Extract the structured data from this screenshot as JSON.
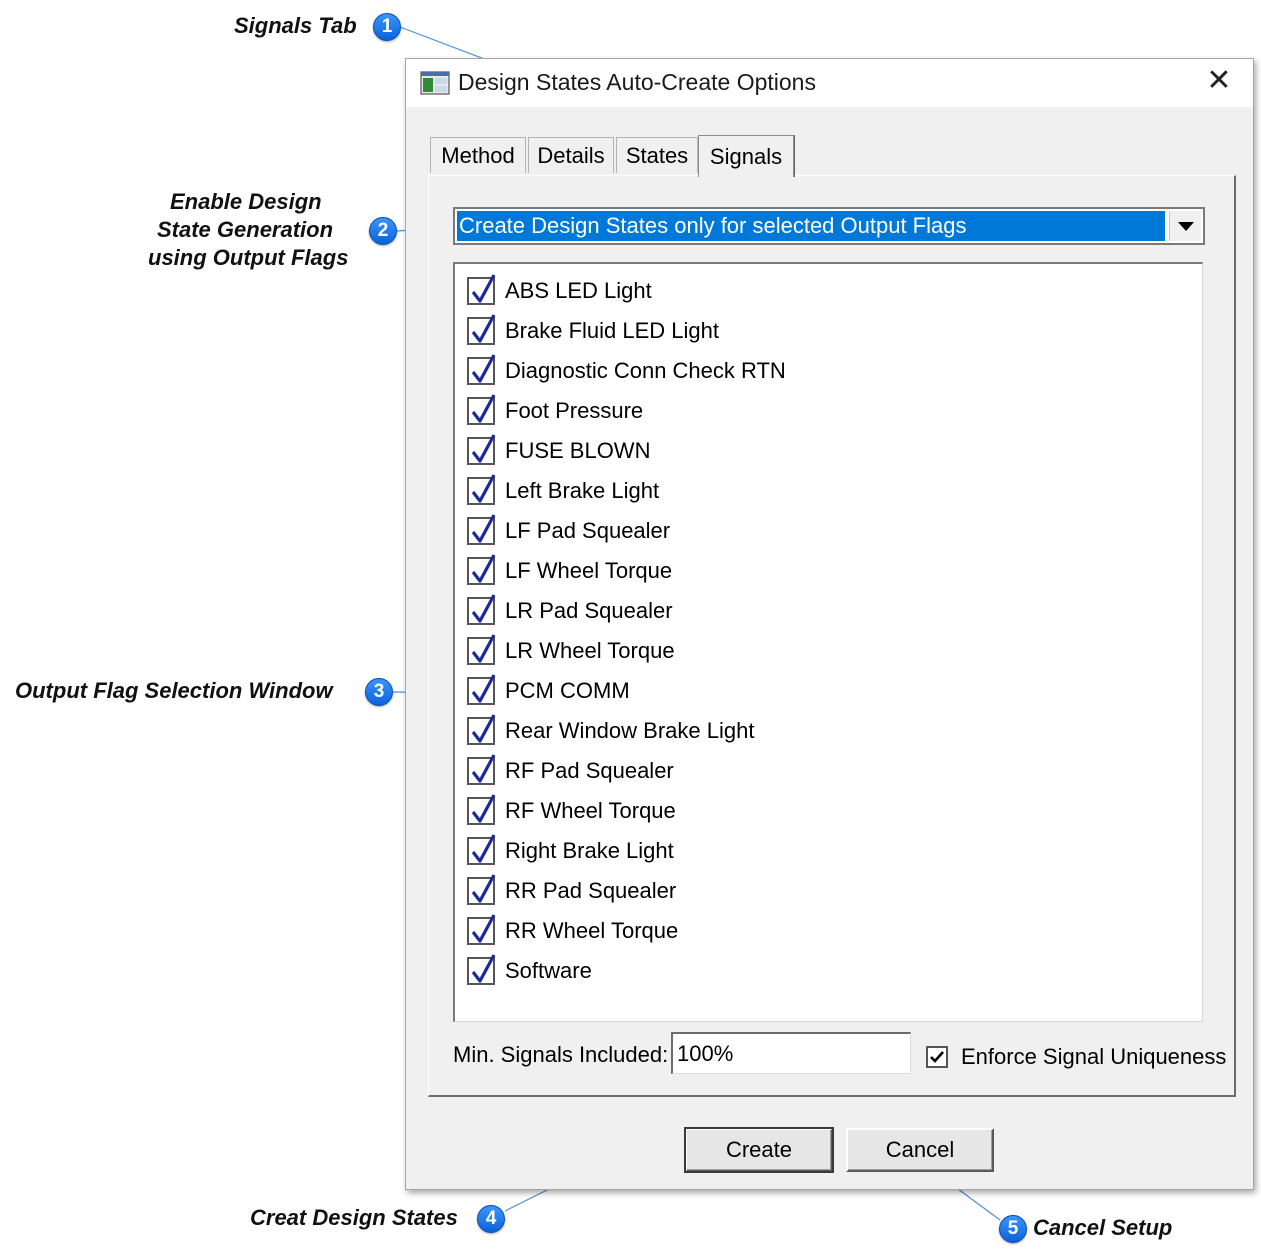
{
  "annotations": [
    {
      "number": "1",
      "text": "Signals Tab"
    },
    {
      "number": "2",
      "lines": [
        "Enable Design",
        "State Generation",
        "using Output Flags"
      ]
    },
    {
      "number": "3",
      "text": "Output Flag Selection Window"
    },
    {
      "number": "4",
      "text": "Creat Design States"
    },
    {
      "number": "5",
      "text": "Cancel Setup"
    }
  ],
  "window": {
    "title": "Design States Auto-Create Options",
    "close_glyph": "✕"
  },
  "tabs": [
    {
      "label": "Method",
      "active": false
    },
    {
      "label": "Details",
      "active": false
    },
    {
      "label": "States",
      "active": false
    },
    {
      "label": "Signals",
      "active": true
    }
  ],
  "signals_panel": {
    "mode_select_value": "Create Design States only for selected Output Flags",
    "output_flags": [
      {
        "label": "ABS LED Light",
        "checked": true
      },
      {
        "label": "Brake Fluid LED Light",
        "checked": true
      },
      {
        "label": "Diagnostic Conn Check RTN",
        "checked": true
      },
      {
        "label": "Foot Pressure",
        "checked": true
      },
      {
        "label": "FUSE BLOWN",
        "checked": true
      },
      {
        "label": "Left Brake Light",
        "checked": true
      },
      {
        "label": "LF Pad Squealer",
        "checked": true
      },
      {
        "label": "LF Wheel Torque",
        "checked": true
      },
      {
        "label": "LR Pad Squealer",
        "checked": true
      },
      {
        "label": "LR Wheel Torque",
        "checked": true
      },
      {
        "label": "PCM COMM",
        "checked": true
      },
      {
        "label": "Rear Window Brake Light",
        "checked": true
      },
      {
        "label": "RF Pad Squealer",
        "checked": true
      },
      {
        "label": "RF Wheel Torque",
        "checked": true
      },
      {
        "label": "Right Brake Light",
        "checked": true
      },
      {
        "label": "RR Pad Squealer",
        "checked": true
      },
      {
        "label": "RR Wheel Torque",
        "checked": true
      },
      {
        "label": "Software",
        "checked": true
      }
    ],
    "min_signals_label": "Min. Signals Included:",
    "min_signals_value": "100%",
    "enforce_uniqueness_label": "Enforce Signal Uniqueness",
    "enforce_uniqueness_checked": true
  },
  "buttons": {
    "create": "Create",
    "cancel": "Cancel"
  },
  "colors": {
    "selection": "#0078d7",
    "badge": "#1a7cf0",
    "checkmark": "#1a2a9c"
  }
}
